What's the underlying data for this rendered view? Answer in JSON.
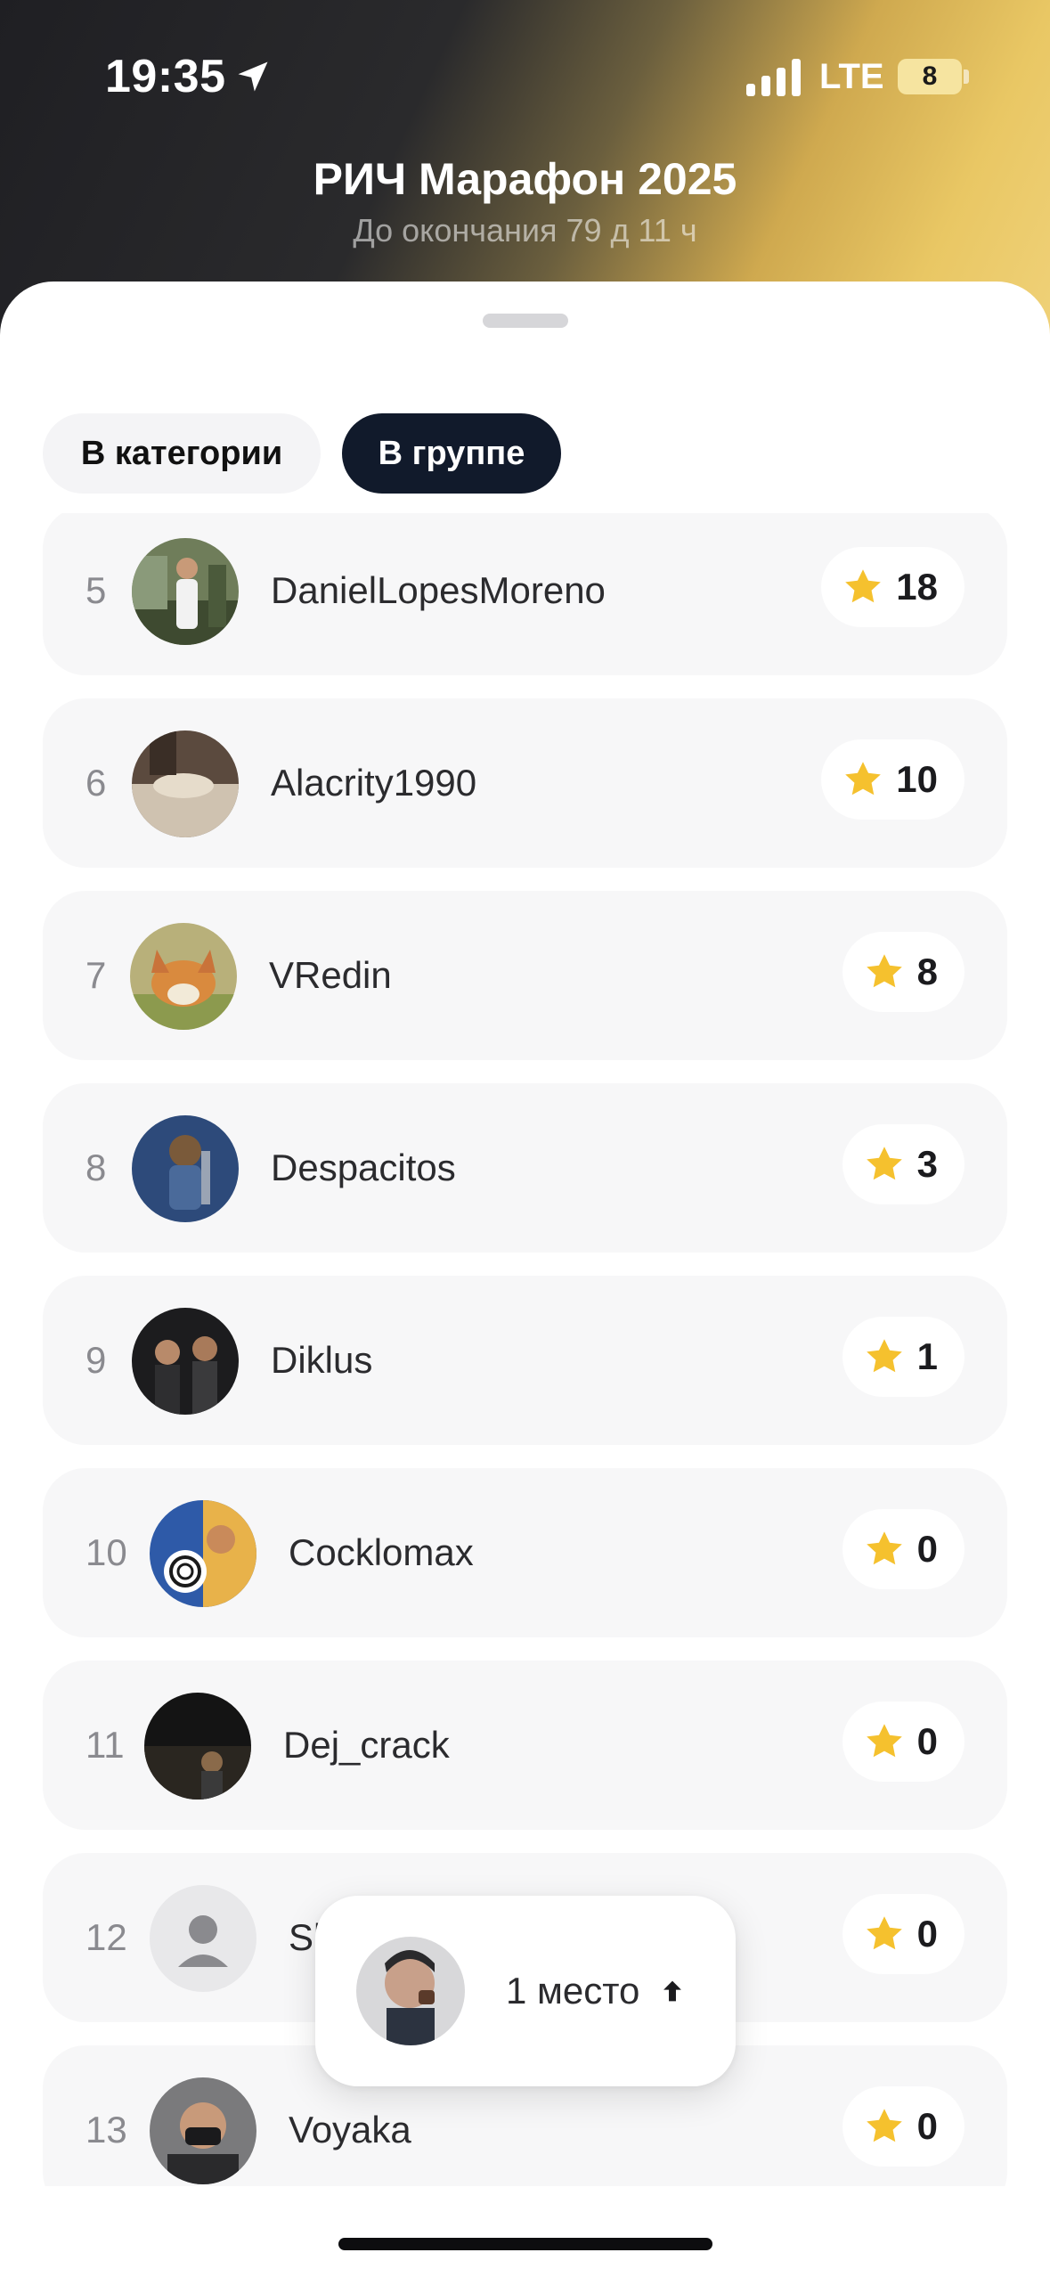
{
  "status_bar": {
    "time": "19:35",
    "network": "LTE",
    "battery": "8"
  },
  "header": {
    "title": "РИЧ Марафон 2025",
    "subtitle": "До окончания 79 д 11 ч"
  },
  "tabs": [
    {
      "label": "В категории",
      "active": false
    },
    {
      "label": "В группе",
      "active": true
    }
  ],
  "leaderboard": [
    {
      "rank": "5",
      "name": "DanielLopesMoreno",
      "score": "18"
    },
    {
      "rank": "6",
      "name": "Alacrity1990",
      "score": "10"
    },
    {
      "rank": "7",
      "name": "VRedin",
      "score": "8"
    },
    {
      "rank": "8",
      "name": "Despacitos",
      "score": "3"
    },
    {
      "rank": "9",
      "name": "Diklus",
      "score": "1"
    },
    {
      "rank": "10",
      "name": "Cocklomax",
      "score": "0"
    },
    {
      "rank": "11",
      "name": "Dej_crack",
      "score": "0"
    },
    {
      "rank": "12",
      "name": "Sl",
      "score": "0"
    },
    {
      "rank": "13",
      "name": "Voyaka",
      "score": "0"
    }
  ],
  "position_toast": {
    "label": "1 место",
    "icon": "arrow-up-icon"
  },
  "colors": {
    "accent": "#111a2b",
    "star": "#f5c12e",
    "gold": "#e9c764"
  }
}
